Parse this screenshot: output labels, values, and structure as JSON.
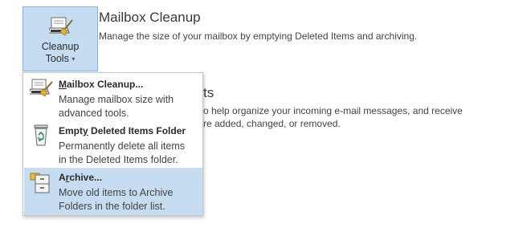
{
  "cleanup_button": {
    "line1": "Cleanup",
    "line2": "Tools",
    "caret": "▾",
    "icon": "cleanup-broom-icon"
  },
  "mailbox_cleanup_section": {
    "title": "Mailbox Cleanup",
    "description": "Manage the size of your mailbox by emptying Deleted Items and archiving."
  },
  "rules_section": {
    "title_partial": "ts",
    "desc_line1": "o help organize your incoming e-mail messages, and receive",
    "desc_line2": "re added, changed, or removed."
  },
  "menu": {
    "items": [
      {
        "title_first": "M",
        "title_rest": "ailbox Cleanup...",
        "desc_line1": "Manage mailbox size with",
        "desc_line2": "advanced tools.",
        "icon": "mailbox-cleanup-icon",
        "highlighted": false
      },
      {
        "title_pre": "Empt",
        "title_ul": "y",
        "title_post": " Deleted Items Folder",
        "desc_line1": "Permanently delete all items",
        "desc_line2": "in the Deleted Items folder.",
        "icon": "recycle-bin-icon",
        "highlighted": false
      },
      {
        "title_first": "A",
        "title_ul": "r",
        "title_rest": "chive...",
        "desc_line1": "Move old items to Archive",
        "desc_line2": "Folders in the folder list.",
        "icon": "archive-cabinet-icon",
        "highlighted": true
      }
    ]
  },
  "colors": {
    "highlight": "#c5dcf1",
    "highlight_border": "#7eb4e3"
  }
}
